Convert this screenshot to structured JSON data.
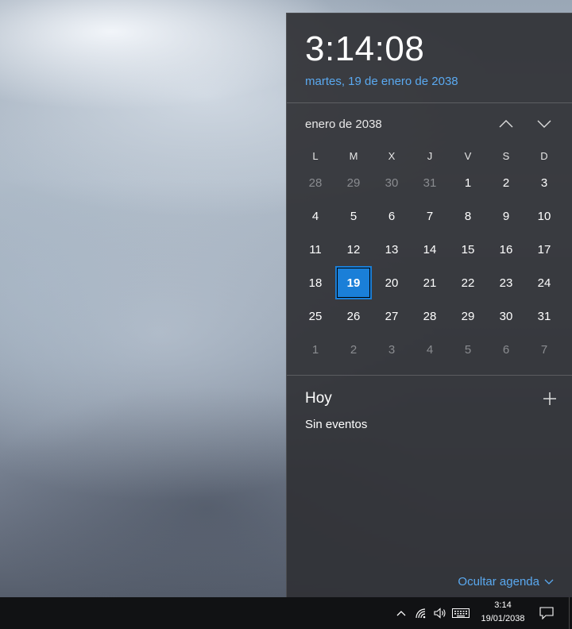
{
  "flyout": {
    "time": "3:14:08",
    "date": "martes, 19 de enero de 2038",
    "month_label": "enero de 2038",
    "nav": {
      "up_icon": "chevron-up-icon",
      "down_icon": "chevron-down-icon"
    },
    "weekdays": [
      "L",
      "M",
      "X",
      "J",
      "V",
      "S",
      "D"
    ],
    "weeks": [
      [
        {
          "d": "28",
          "dim": true
        },
        {
          "d": "29",
          "dim": true
        },
        {
          "d": "30",
          "dim": true
        },
        {
          "d": "31",
          "dim": true
        },
        {
          "d": "1"
        },
        {
          "d": "2"
        },
        {
          "d": "3"
        }
      ],
      [
        {
          "d": "4"
        },
        {
          "d": "5"
        },
        {
          "d": "6"
        },
        {
          "d": "7"
        },
        {
          "d": "8"
        },
        {
          "d": "9"
        },
        {
          "d": "10"
        }
      ],
      [
        {
          "d": "11"
        },
        {
          "d": "12"
        },
        {
          "d": "13"
        },
        {
          "d": "14"
        },
        {
          "d": "15"
        },
        {
          "d": "16"
        },
        {
          "d": "17"
        }
      ],
      [
        {
          "d": "18"
        },
        {
          "d": "19",
          "today": true
        },
        {
          "d": "20"
        },
        {
          "d": "21"
        },
        {
          "d": "22"
        },
        {
          "d": "23"
        },
        {
          "d": "24"
        }
      ],
      [
        {
          "d": "25"
        },
        {
          "d": "26"
        },
        {
          "d": "27"
        },
        {
          "d": "28"
        },
        {
          "d": "29"
        },
        {
          "d": "30"
        },
        {
          "d": "31"
        }
      ],
      [
        {
          "d": "1",
          "dim": true
        },
        {
          "d": "2",
          "dim": true
        },
        {
          "d": "3",
          "dim": true
        },
        {
          "d": "4",
          "dim": true
        },
        {
          "d": "5",
          "dim": true
        },
        {
          "d": "6",
          "dim": true
        },
        {
          "d": "7",
          "dim": true
        }
      ]
    ],
    "agenda": {
      "title": "Hoy",
      "no_events": "Sin eventos",
      "hide_label": "Ocultar agenda"
    }
  },
  "taskbar": {
    "time": "3:14",
    "date": "19/01/2038",
    "icons": [
      "chevron-up-icon",
      "wifi-icon",
      "speaker-icon",
      "keyboard-icon",
      "notification-icon"
    ]
  },
  "colors": {
    "accent": "#1a7fd8",
    "link": "#5aa9f0",
    "flyout_bg": "#303236",
    "taskbar_bg": "#111214"
  }
}
